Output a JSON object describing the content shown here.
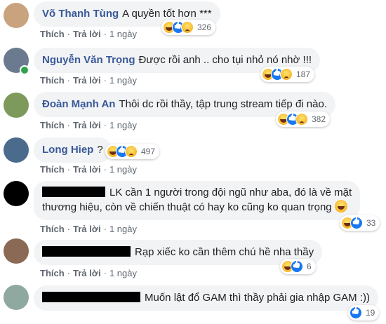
{
  "labels": {
    "like": "Thích",
    "reply": "Trả lời",
    "sep": "·"
  },
  "comments": [
    {
      "author": "Võ Thanh Tùng",
      "text": "A quyền tốt hơn ***",
      "time": "1 ngày",
      "reactions": [
        "haha",
        "like",
        "sad"
      ],
      "count": "326",
      "avatar_color": "#c9a27e"
    },
    {
      "author": "Nguyễn Văn Trọng",
      "text": "Được rồi anh .. cho tụi nhỏ nó nhờ !!!",
      "time": "1 ngày",
      "reactions": [
        "haha",
        "like",
        "sad"
      ],
      "count": "187",
      "online": true,
      "avatar_color": "#6b7a8f"
    },
    {
      "author": "Đoàn Mạnh An",
      "text": "Thôi dc rồi thầy, tập trung stream tiếp đi nào.",
      "time": "1 ngày",
      "reactions": [
        "haha",
        "like",
        "sad"
      ],
      "count": "382",
      "avatar_color": "#7d9a5c"
    },
    {
      "author": "Long Hiep",
      "text": "?",
      "time": "1 ngày",
      "reactions": [
        "haha",
        "like",
        "sad"
      ],
      "count": "497",
      "avatar_color": "#4a6b8c"
    },
    {
      "author": "",
      "text_line1": "LK cần 1 người trong đội ngũ như aba, đó là về mặt",
      "text_line2": "thương hiệu, còn về chiến thuật có hay ko cũng ko quan trọng",
      "time": "1 ngày",
      "reactions": [
        "haha",
        "like"
      ],
      "count": "33",
      "avatar_color": "#000000",
      "redacted": true
    },
    {
      "author": "",
      "text": "Rạp xiếc ko cần thêm chú hề nha thầy",
      "time": "1 ngày",
      "reactions": [
        "haha",
        "like"
      ],
      "count": "6",
      "avatar_color": "#8a6a55",
      "redacted": true
    },
    {
      "author": "",
      "text": "Muốn lật đổ GAM thì thầy phải gia nhập GAM :))",
      "time": "1 ngày",
      "reactions": [
        "like"
      ],
      "count": "19",
      "avatar_color": "#8fa8a0",
      "redacted": true
    }
  ]
}
